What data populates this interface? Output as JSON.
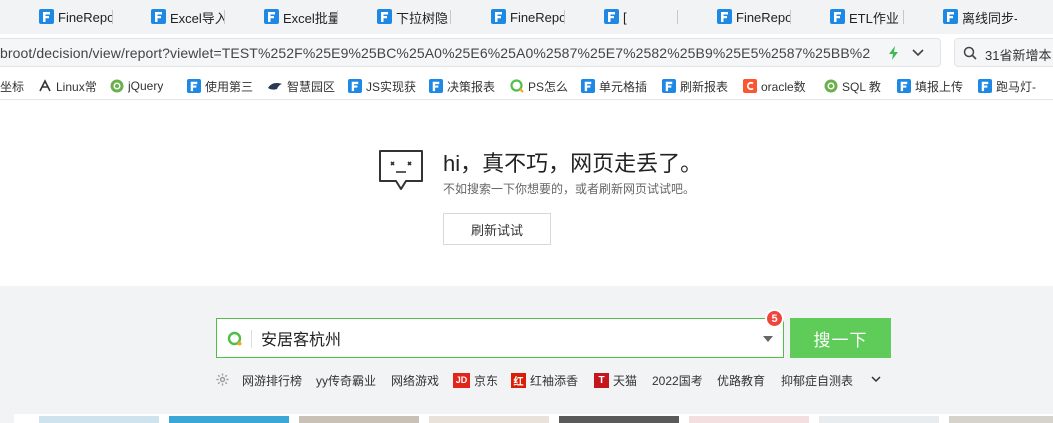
{
  "tabs": [
    {
      "title": "FineRepo",
      "icon": "finereport-icon"
    },
    {
      "title": "Excel导入",
      "icon": "finereport-icon"
    },
    {
      "title": "Excel批量",
      "icon": "finereport-icon"
    },
    {
      "title": "下拉树隐",
      "icon": "finereport-icon"
    },
    {
      "title": "FineRepo",
      "icon": "finereport-icon"
    },
    {
      "title": "[",
      "icon": "finereport-icon"
    },
    {
      "title": "FineRepo",
      "icon": "finereport-icon"
    },
    {
      "title": "ETL作业",
      "icon": "finereport-icon"
    },
    {
      "title": "离线同步-",
      "icon": "finereport-icon"
    }
  ],
  "address": {
    "url": "broot/decision/view/report?viewlet=TEST%252F%25E9%25BC%25A0%25E6%25A0%2587%25E7%2582%25B9%25E5%2587%25BB%2",
    "side_search": "31省新增本"
  },
  "bookmarks": [
    {
      "label": "坐标",
      "icon": "page-icon"
    },
    {
      "label": "Linux常",
      "icon": "linux-icon"
    },
    {
      "label": "jQuery",
      "icon": "jquery-icon"
    },
    {
      "label": "使用第三",
      "icon": "finereport-icon"
    },
    {
      "label": "智慧园区",
      "icon": "bird-icon"
    },
    {
      "label": "JS实现获",
      "icon": "finereport-icon"
    },
    {
      "label": "决策报表",
      "icon": "finereport-icon"
    },
    {
      "label": "PS怎么",
      "icon": "qihoo-search-icon"
    },
    {
      "label": "单元格插",
      "icon": "finereport-icon"
    },
    {
      "label": "刷新报表",
      "icon": "finereport-icon"
    },
    {
      "label": "oracle数",
      "icon": "csdn-icon"
    },
    {
      "label": "SQL 教",
      "icon": "jquery-icon"
    },
    {
      "label": "填报上传",
      "icon": "finereport-icon"
    },
    {
      "label": "跑马灯-",
      "icon": "finereport-icon"
    }
  ],
  "error": {
    "title": "hi，真不巧，网页走丢了。",
    "subtitle": "不如搜索一下你想要的，或者刷新网页试试吧。",
    "retry_label": "刷新试试"
  },
  "search": {
    "value": "安居客杭州",
    "badge_count": "5",
    "button_label": "搜一下"
  },
  "hot_links": [
    {
      "label": "网游排行榜",
      "icon": ""
    },
    {
      "label": "yy传奇霸业",
      "icon": ""
    },
    {
      "label": "网络游戏",
      "icon": ""
    },
    {
      "label": "京东",
      "icon": "jd-icon",
      "glyph": "JD",
      "color": "#e1251b"
    },
    {
      "label": "红袖添香",
      "icon": "hongxiu-icon",
      "glyph": "红",
      "color": "#d81e06"
    },
    {
      "label": "天猫",
      "icon": "tmall-icon",
      "glyph": "T",
      "color": "#c4161c"
    },
    {
      "label": "2022国考",
      "icon": ""
    },
    {
      "label": "优路教育",
      "icon": ""
    },
    {
      "label": "抑郁症自测表",
      "icon": ""
    }
  ],
  "colors": {
    "accent_green": "#5fcc5a",
    "finereport_blue": "#1e88e5",
    "badge_red": "#f0433a"
  }
}
